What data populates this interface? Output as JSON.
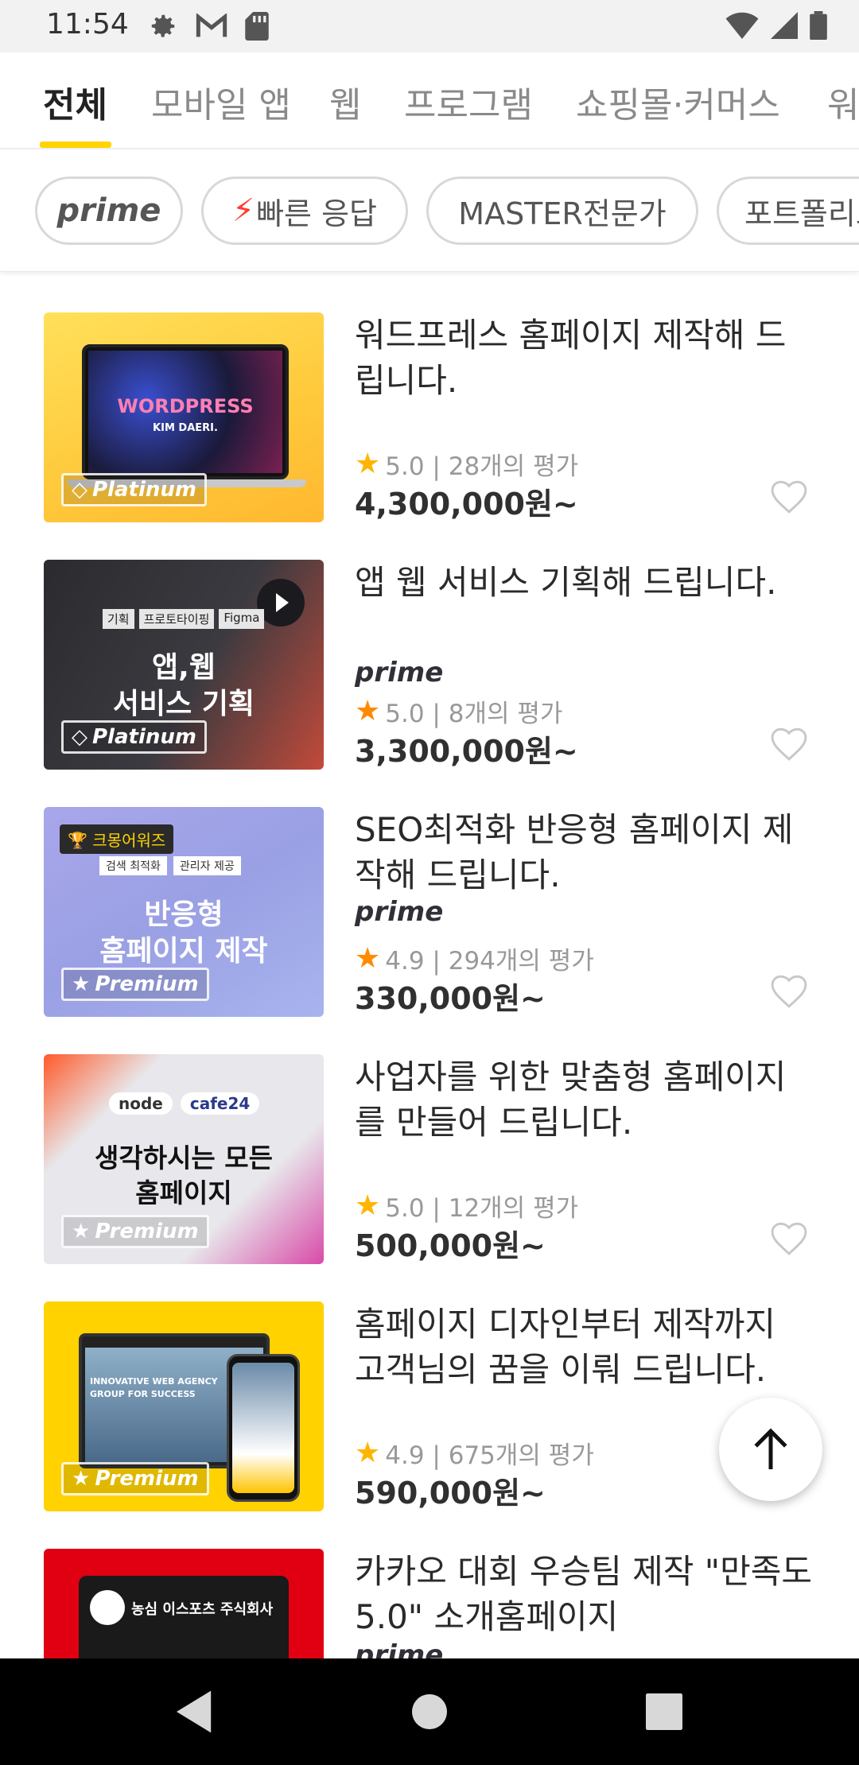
{
  "status_bar": {
    "time": "11:54"
  },
  "tabs": [
    {
      "label": "전체",
      "active": true
    },
    {
      "label": "모바일 앱"
    },
    {
      "label": "웹"
    },
    {
      "label": "프로그램"
    },
    {
      "label": "쇼핑몰·커머스"
    },
    {
      "label": "워"
    }
  ],
  "chips": [
    {
      "label": "prime"
    },
    {
      "label": "빠른 응답"
    },
    {
      "label": "MASTER전문가"
    },
    {
      "label": "포트폴리오"
    }
  ],
  "items": [
    {
      "title": "워드프레스 홈페이지 제작해 드립니다.",
      "thumb_texts": [
        "WORDPRESS",
        "KIM DAERI."
      ],
      "badge": "Platinum",
      "rating": "5.0 | 28개의 평가",
      "price": "4,300,000원~",
      "prime": ""
    },
    {
      "title": "앱 웹 서비스 기획해 드립니다.",
      "thumb_texts": [
        "기획",
        "프로토타이핑",
        "Figma",
        "앱,웹",
        "서비스 기획"
      ],
      "badge": "Platinum",
      "prime": "prime",
      "rating": "5.0 | 8개의 평가",
      "price": "3,300,000원~"
    },
    {
      "title": "SEO최적화 반응형 홈페이지 제작해 드립니다.",
      "thumb_texts": [
        "크몽어워즈",
        "검색 최적화",
        "관리자 제공",
        "반응형",
        "홈페이지 제작"
      ],
      "badge": "Premium",
      "prime": "prime",
      "rating": "4.9 | 294개의 평가",
      "price": "330,000원~"
    },
    {
      "title": "사업자를 위한 맞춤형 홈페이지를 만들어 드립니다.",
      "thumb_texts": [
        "node",
        "cafe24",
        "생각하시는 모든",
        "홈페이지"
      ],
      "badge": "Premium",
      "rating": "5.0 | 12개의 평가",
      "price": "500,000원~",
      "prime": ""
    },
    {
      "title": "홈페이지 디자인부터 제작까지 고객님의 꿈을 이뤄 드립니다.",
      "thumb_texts": [
        "INNOVATIVE WEB AGENCY",
        "GROUP FOR SUCCESS"
      ],
      "badge": "Premium",
      "rating": "4.9 | 675개의 평가",
      "price": "590,000원~",
      "prime": ""
    },
    {
      "title": "카카오 대회 우승팀 제작 \"만족도 5.0\" 소개홈페이지",
      "thumb_texts": [
        "농심 이스포츠 주식회사"
      ],
      "prime": "prime",
      "badge": "",
      "rating": "",
      "price": ""
    }
  ],
  "colors": {
    "accent": "#ffd400",
    "star": "#ffb400",
    "bolt": "#ff3b30"
  },
  "icons": [
    "gear-icon",
    "gmail-icon",
    "sd-card-icon",
    "wifi-icon",
    "signal-icon",
    "battery-icon",
    "star-icon",
    "heart-icon",
    "arrow-up-icon",
    "back-icon",
    "home-icon",
    "recents-icon"
  ]
}
